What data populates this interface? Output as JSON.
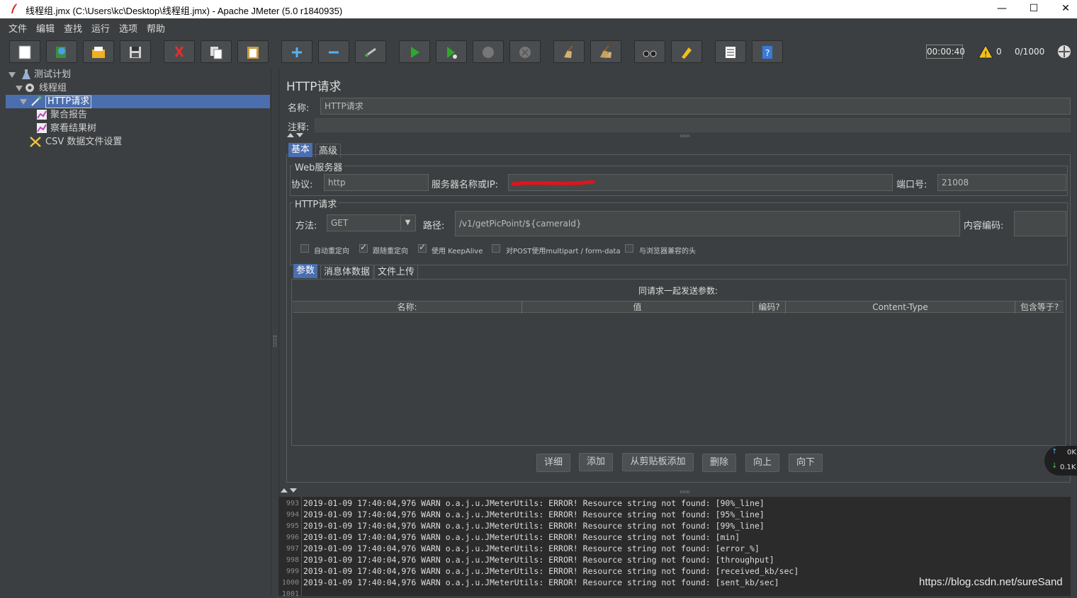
{
  "window": {
    "title": "线程组.jmx (C:\\Users\\kc\\Desktop\\线程组.jmx) - Apache JMeter (5.0 r1840935)",
    "minimize": "—",
    "maximize": "☐",
    "close": "✕"
  },
  "menu": [
    "文件",
    "编辑",
    "查找",
    "运行",
    "选项",
    "帮助"
  ],
  "toolbar": {
    "timer": "00:00:40",
    "warnings": "0",
    "threads": "0/1000"
  },
  "tree": {
    "items": [
      {
        "label": "测试计划",
        "icon": "flask-icon"
      },
      {
        "label": "线程组",
        "icon": "gear-icon"
      },
      {
        "label": "HTTP请求",
        "icon": "pipette-icon"
      },
      {
        "label": "聚合报告",
        "icon": "graph-icon"
      },
      {
        "label": "察看结果树",
        "icon": "graph-icon"
      },
      {
        "label": "CSV 数据文件设置",
        "icon": "scissors-icon"
      }
    ]
  },
  "panel": {
    "title": "HTTP请求",
    "name_label": "名称:",
    "name_value": "HTTP请求",
    "comment_label": "注释:",
    "tabs": [
      "基本",
      "高级"
    ],
    "web_server": {
      "legend": "Web服务器",
      "protocol_label": "协议:",
      "protocol_value": "http",
      "server_label": "服务器名称或IP:",
      "port_label": "端口号:",
      "port_value": "21008"
    },
    "http_request": {
      "legend": "HTTP请求",
      "method_label": "方法:",
      "method_value": "GET",
      "path_label": "路径:",
      "path_value": "/v1/getPicPoint/${cameraId}",
      "encoding_label": "内容编码:"
    },
    "checkboxes": [
      {
        "label": "自动重定向",
        "checked": false
      },
      {
        "label": "跟随重定向",
        "checked": true
      },
      {
        "label": "使用 KeepAlive",
        "checked": true
      },
      {
        "label": "对POST使用multipart / form-data",
        "checked": false
      },
      {
        "label": "与浏览器兼容的头",
        "checked": false
      }
    ],
    "sub_tabs": [
      "参数",
      "消息体数据",
      "文件上传"
    ],
    "params_title": "同请求一起发送参数:",
    "columns": [
      "名称:",
      "值",
      "编码?",
      "Content-Type",
      "包含等于?"
    ],
    "buttons": [
      "详细",
      "添加",
      "从剪贴板添加",
      "删除",
      "向上",
      "向下"
    ]
  },
  "net_widget": {
    "up": "0K",
    "down": "0.1K"
  },
  "log": {
    "lines": [
      {
        "n": "993",
        "text": "2019-01-09 17:40:04,976 WARN o.a.j.u.JMeterUtils: ERROR! Resource string not found: [90%_line]"
      },
      {
        "n": "994",
        "text": "2019-01-09 17:40:04,976 WARN o.a.j.u.JMeterUtils: ERROR! Resource string not found: [95%_line]"
      },
      {
        "n": "995",
        "text": "2019-01-09 17:40:04,976 WARN o.a.j.u.JMeterUtils: ERROR! Resource string not found: [99%_line]"
      },
      {
        "n": "996",
        "text": "2019-01-09 17:40:04,976 WARN o.a.j.u.JMeterUtils: ERROR! Resource string not found: [min]"
      },
      {
        "n": "997",
        "text": "2019-01-09 17:40:04,976 WARN o.a.j.u.JMeterUtils: ERROR! Resource string not found: [error_%]"
      },
      {
        "n": "998",
        "text": "2019-01-09 17:40:04,976 WARN o.a.j.u.JMeterUtils: ERROR! Resource string not found: [throughput]"
      },
      {
        "n": "999",
        "text": "2019-01-09 17:40:04,976 WARN o.a.j.u.JMeterUtils: ERROR! Resource string not found: [received_kb/sec]"
      },
      {
        "n": "1000",
        "text": "2019-01-09 17:40:04,976 WARN o.a.j.u.JMeterUtils: ERROR! Resource string not found: [sent_kb/sec]"
      },
      {
        "n": "1001",
        "text": ""
      }
    ]
  },
  "watermark": "https://blog.csdn.net/sureSand"
}
